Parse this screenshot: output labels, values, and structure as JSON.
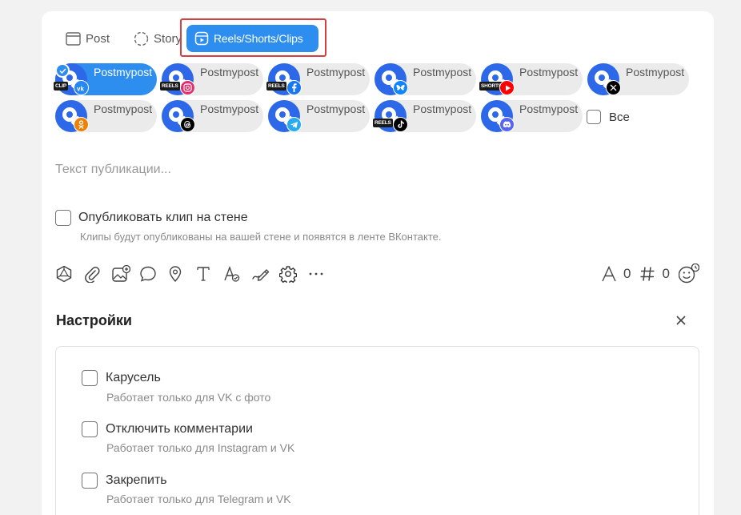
{
  "tabs": {
    "post_label": "Post",
    "story_label": "Story",
    "reels_label": "Reels/Shorts/Clips"
  },
  "accounts": [
    {
      "name": "Postmypost",
      "network": "vk",
      "badge": "CLIP",
      "selected": true,
      "color": "#2787f5"
    },
    {
      "name": "Postmypost",
      "network": "instagram",
      "badge": "REELS",
      "selected": false,
      "color": "#e1306c"
    },
    {
      "name": "Postmypost",
      "network": "facebook",
      "badge": "REELS",
      "selected": false,
      "color": "#1877f2"
    },
    {
      "name": "Postmypost",
      "network": "bluesky",
      "badge": "",
      "selected": false,
      "color": "#1185fe"
    },
    {
      "name": "Postmypost",
      "network": "youtube",
      "badge": "SHORTS",
      "selected": false,
      "color": "#ff0000"
    },
    {
      "name": "Postmypost",
      "network": "x",
      "badge": "",
      "selected": false,
      "color": "#000000"
    },
    {
      "name": "Postmypost",
      "network": "ok",
      "badge": "",
      "selected": false,
      "color": "#ee8208"
    },
    {
      "name": "Postmypost",
      "network": "threads",
      "badge": "",
      "selected": false,
      "color": "#000000"
    },
    {
      "name": "Postmypost",
      "network": "telegram",
      "badge": "",
      "selected": false,
      "color": "#2aabee"
    },
    {
      "name": "Postmypost",
      "network": "tiktok",
      "badge": "REELS",
      "selected": false,
      "color": "#000000"
    },
    {
      "name": "Postmypost",
      "network": "discord",
      "badge": "",
      "selected": false,
      "color": "#5865f2"
    }
  ],
  "select_all_label": "Все",
  "editor": {
    "placeholder": "Текст публикации..."
  },
  "clip_option": {
    "label": "Опубликовать клип на стене",
    "hint": "Клипы будут опубликованы на вашей стене и появятся в ленте ВКонтакте."
  },
  "toolbar_icons": [
    "ai-icon",
    "attach-icon",
    "media-icon",
    "comment-icon",
    "location-icon",
    "text-icon",
    "font-style-icon",
    "signature-icon",
    "settings-icon",
    "more-icon"
  ],
  "counters": {
    "chars": "0",
    "hashtags": "0"
  },
  "settings": {
    "title": "Настройки",
    "options": [
      {
        "label": "Карусель",
        "hint": "Работает только для VK с фото"
      },
      {
        "label": "Отключить комментарии",
        "hint": "Работает только для Instagram и VK"
      },
      {
        "label": "Закрепить",
        "hint": "Работает только для Telegram и VK"
      }
    ]
  },
  "colors": {
    "accent": "#2d8ef0",
    "highlight_border": "#d63f3f",
    "avatar": "#2c68e8"
  }
}
